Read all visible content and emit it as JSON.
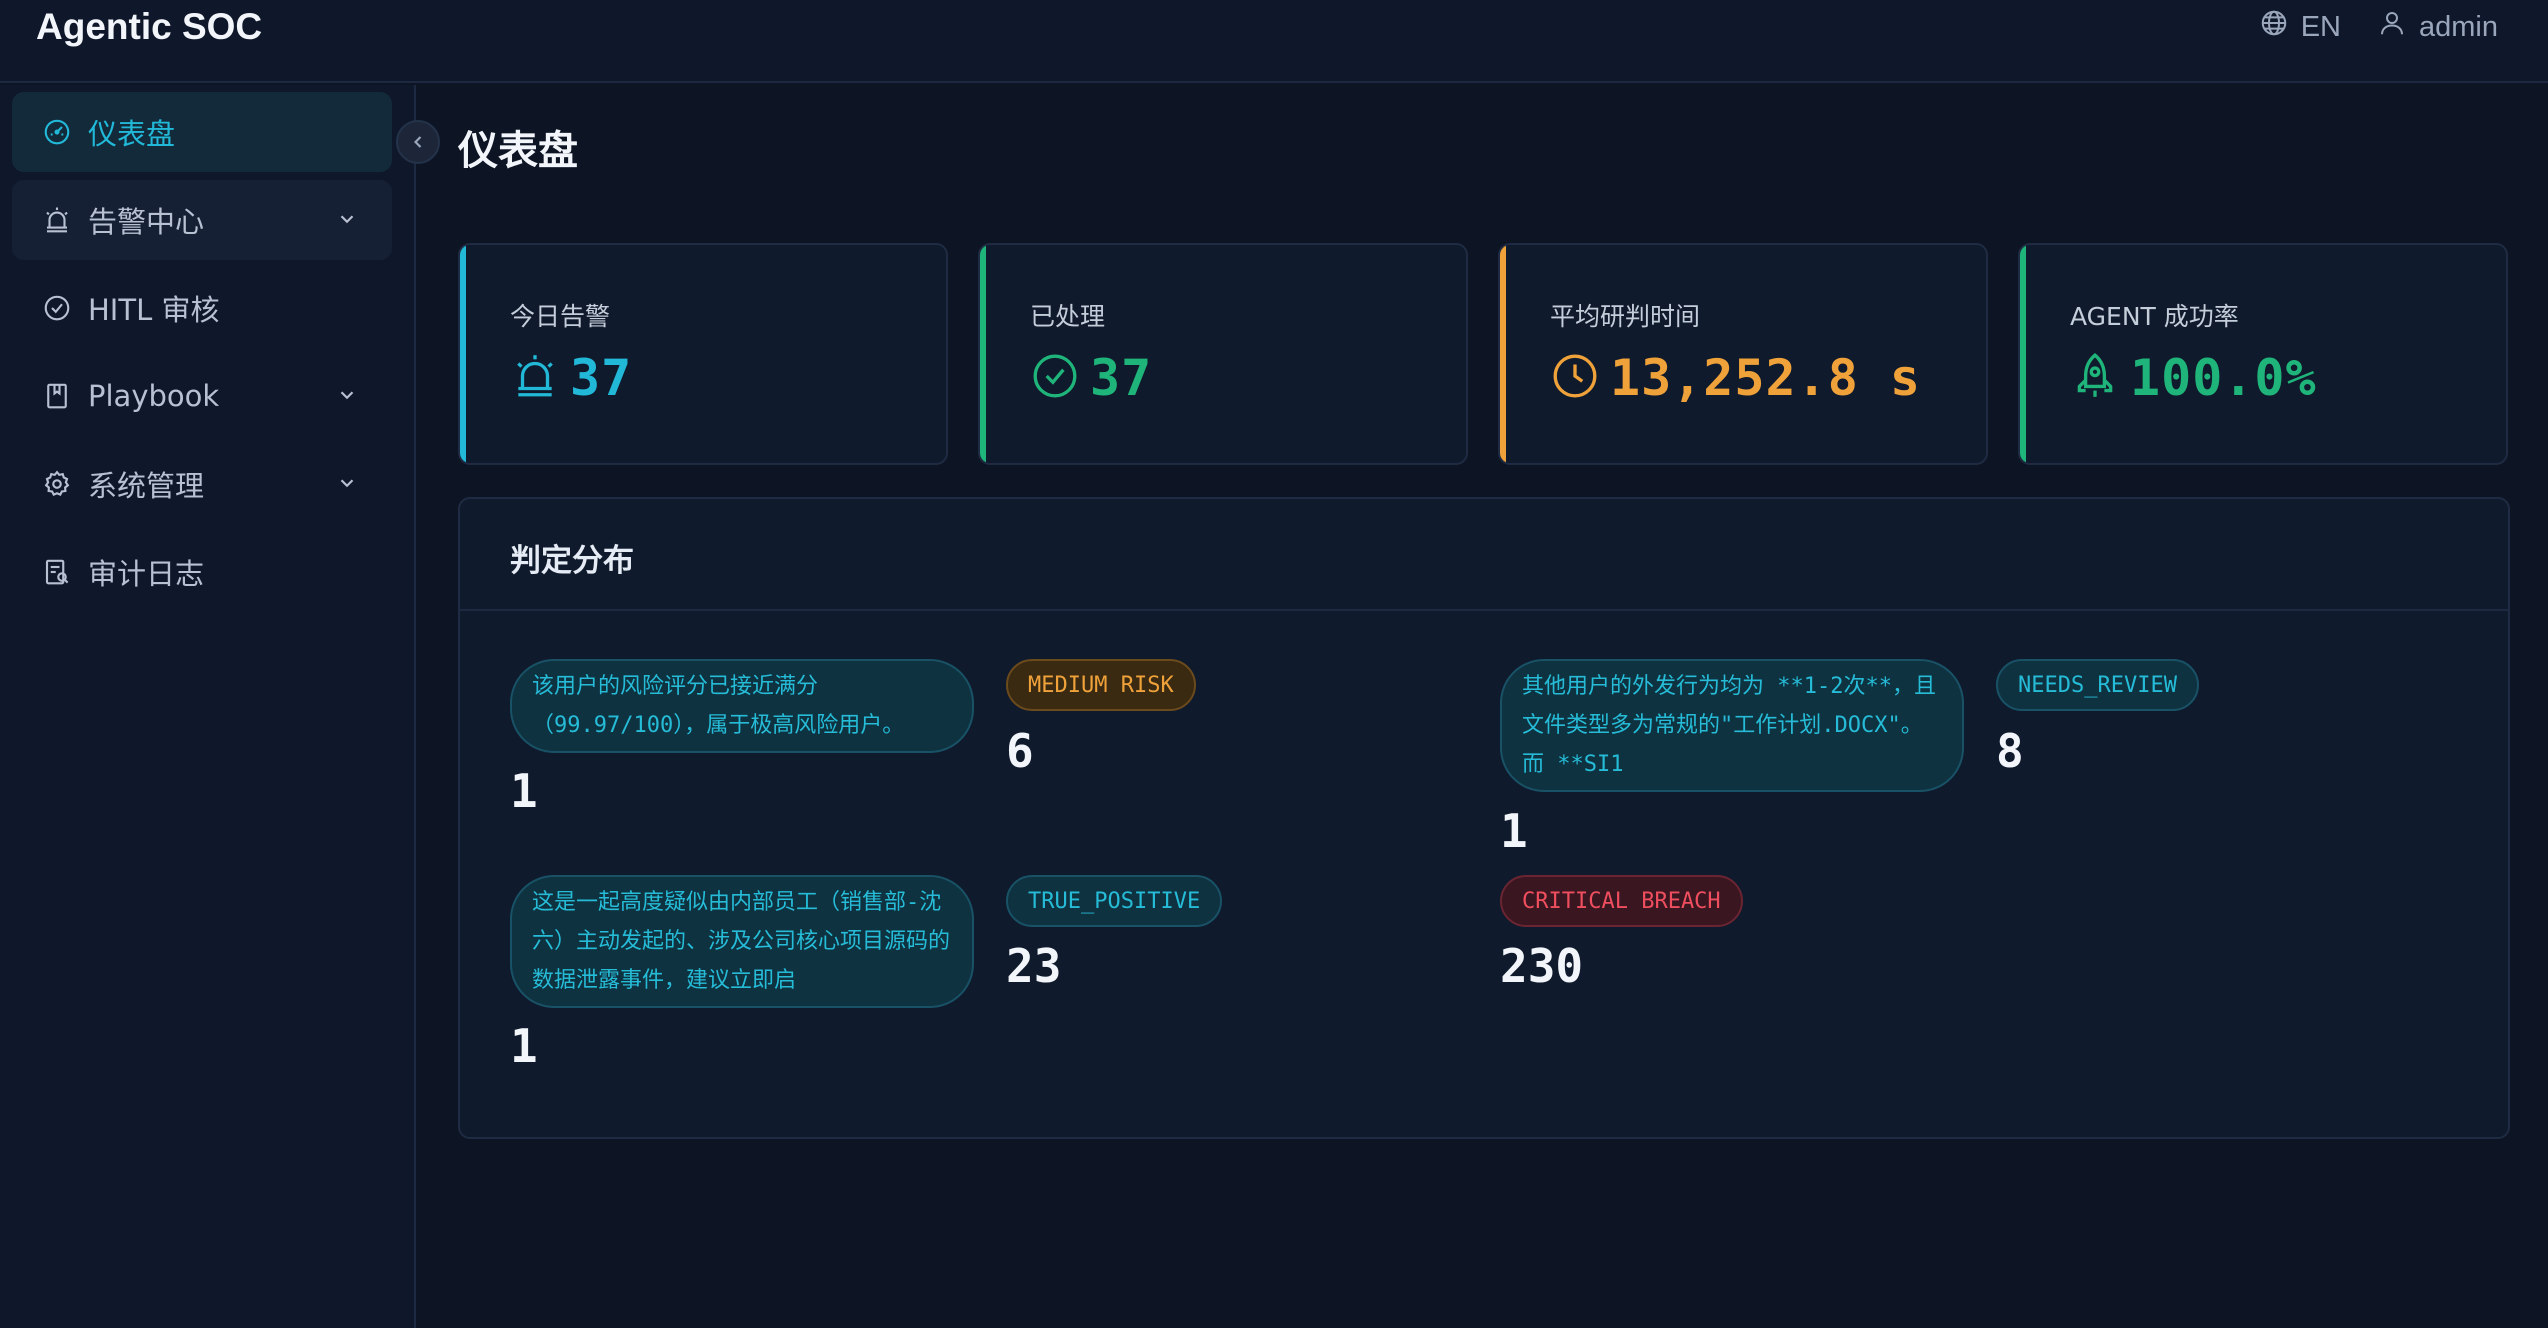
{
  "header": {
    "app_title": "Agentic SOC",
    "language": "EN",
    "user": "admin"
  },
  "sidebar": {
    "items": [
      {
        "label": "仪表盘",
        "icon": "dashboard-icon",
        "active": true
      },
      {
        "label": "告警中心",
        "icon": "alarm-icon",
        "has_submenu": true
      },
      {
        "label": "HITL 审核",
        "icon": "check-circle-icon"
      },
      {
        "label": "Playbook",
        "icon": "book-icon",
        "has_submenu": true
      },
      {
        "label": "系统管理",
        "icon": "gear-icon",
        "has_submenu": true
      },
      {
        "label": "审计日志",
        "icon": "audit-log-icon"
      }
    ]
  },
  "main": {
    "title": "仪表盘",
    "stats": [
      {
        "label": "今日告警",
        "value": "37",
        "icon": "alarm-icon",
        "color": "#22b8d8"
      },
      {
        "label": "已处理",
        "value": "37",
        "icon": "check-circle-icon",
        "color": "#1fb57a"
      },
      {
        "label": "平均研判时间",
        "value": "13,252.8 s",
        "icon": "clock-icon",
        "color": "#f0a23a"
      },
      {
        "label": "AGENT 成功率",
        "value": "100.0%",
        "icon": "rocket-icon",
        "color": "#1fb57a"
      }
    ],
    "distribution": {
      "title": "判定分布",
      "items": [
        {
          "label": "该用户的风险评分已接近满分（99.97/100），属于极高风险用户。",
          "count": "1",
          "color": "cyan"
        },
        {
          "label": "MEDIUM RISK",
          "count": "6",
          "color": "orange"
        },
        {
          "label": "其他用户的外发行为均为 **1-2次**，且文件类型多为常规的\"工作计划.DOCX\"。而 **SI1",
          "count": "1",
          "color": "cyan"
        },
        {
          "label": "NEEDS_REVIEW",
          "count": "8",
          "color": "cyan"
        },
        {
          "label": "这是一起高度疑似由内部员工（销售部-沈六）主动发起的、涉及公司核心项目源码的数据泄露事件，建议立即启",
          "count": "1",
          "color": "cyan"
        },
        {
          "label": "TRUE_POSITIVE",
          "count": "23",
          "color": "cyan"
        },
        {
          "label": "CRITICAL BREACH",
          "count": "230",
          "color": "red"
        }
      ]
    }
  }
}
